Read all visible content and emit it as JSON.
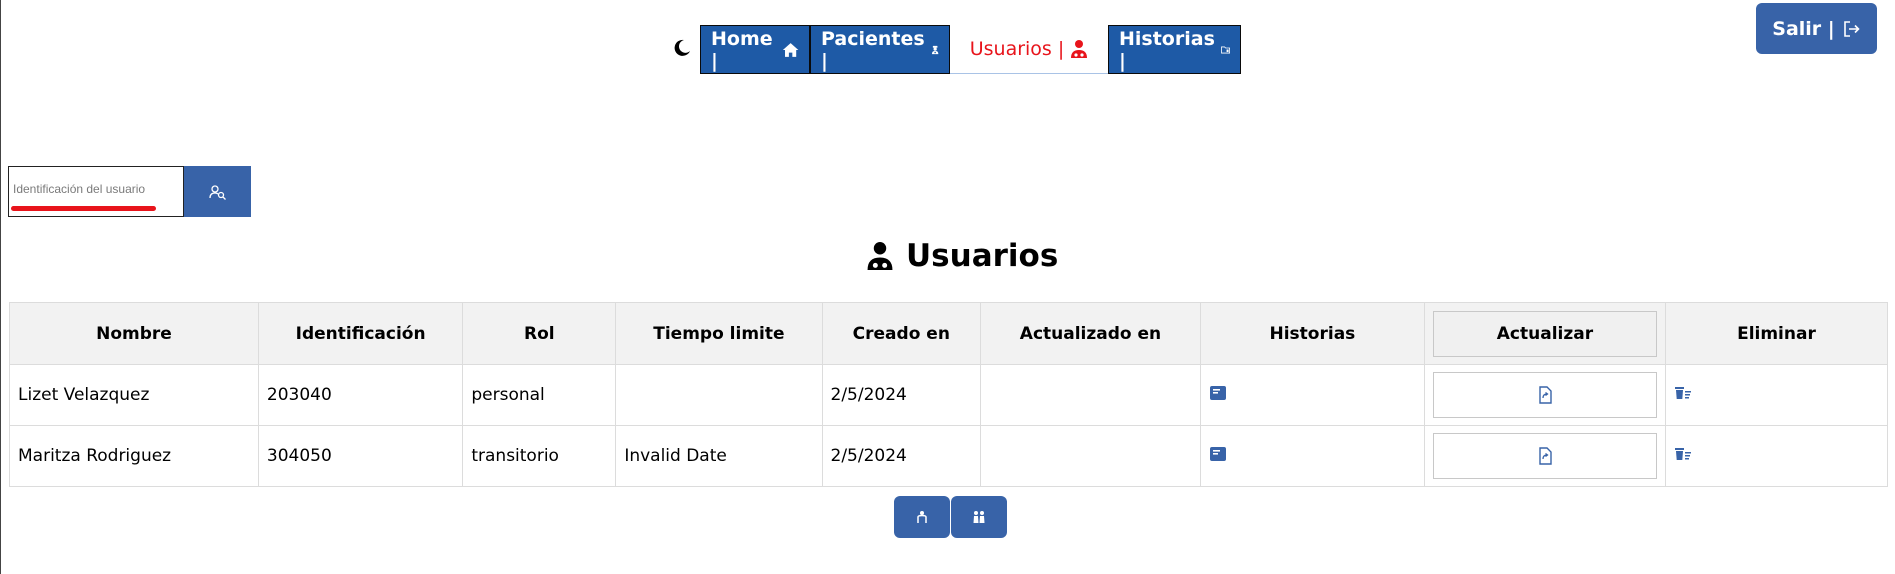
{
  "nav": {
    "items": [
      {
        "label": "Home |",
        "icon": "home-icon"
      },
      {
        "label": "Pacientes |",
        "icon": "doctor-icon"
      },
      {
        "label": "Usuarios |",
        "icon": "user-doctor-icon",
        "active": true
      },
      {
        "label": "Historias |",
        "icon": "folder-icon"
      }
    ],
    "theme_icon": "moon-icon"
  },
  "logout": {
    "label": "Salir |",
    "icon": "sign-out-icon"
  },
  "search": {
    "placeholder": "Identificación del usuario",
    "button_icon": "user-search-icon"
  },
  "page": {
    "title": "Usuarios",
    "title_icon": "user-doctor-icon"
  },
  "table": {
    "headers": [
      "Nombre",
      "Identificación",
      "Rol",
      "Tiempo limite",
      "Creado en",
      "Actualizado en",
      "Historias",
      "Actualizar",
      "Eliminar"
    ],
    "rows": [
      {
        "nombre": "Lizet Velazquez",
        "identificacion": "203040",
        "rol": "personal",
        "tiempo_limite": "",
        "creado_en": "2/5/2024",
        "actualizado_en": ""
      },
      {
        "nombre": "Maritza Rodriguez",
        "identificacion": "304050",
        "rol": "transitorio",
        "tiempo_limite": "Invalid Date",
        "creado_en": "2/5/2024",
        "actualizado_en": ""
      }
    ],
    "row_icons": {
      "historias": "book-icon",
      "actualizar": "file-update-icon",
      "eliminar": "trash-list-icon"
    }
  },
  "pager": {
    "prev_icon": "prev-users-icon",
    "next_icon": "next-users-icon"
  },
  "colors": {
    "nav_blue": "#1e5aa6",
    "button_blue": "#3863a8",
    "active_red": "#e8141b",
    "header_gray": "#f2f2f2"
  }
}
